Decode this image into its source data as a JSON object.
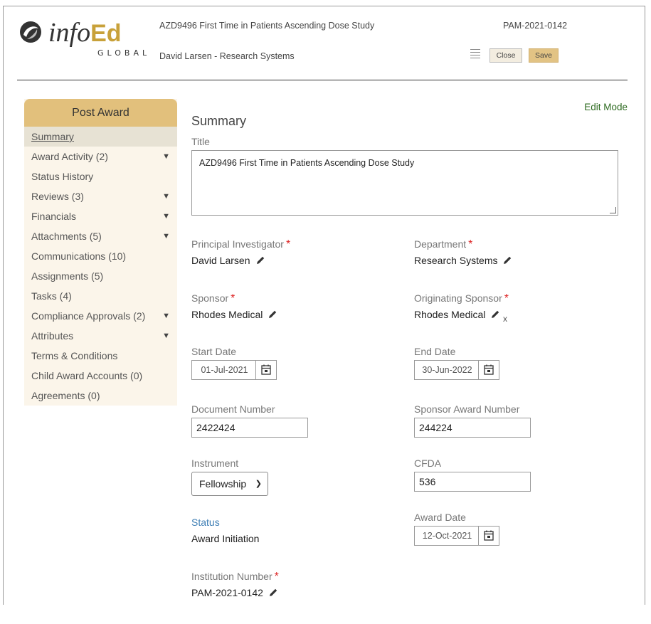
{
  "header": {
    "logo_main": "info",
    "logo_accent": "Ed",
    "logo_sub": "GLOBAL",
    "record_title": "AZD9496 First Time in Patients Ascending Dose Study",
    "record_id": "PAM-2021-0142",
    "user_line": "David Larsen - Research Systems",
    "close_label": "Close",
    "save_label": "Save"
  },
  "sidebar": {
    "title": "Post Award",
    "items": [
      {
        "label": "Summary",
        "expandable": false,
        "active": true
      },
      {
        "label": "Award Activity (2)",
        "expandable": true
      },
      {
        "label": "Status History",
        "expandable": false
      },
      {
        "label": "Reviews (3)",
        "expandable": true
      },
      {
        "label": "Financials",
        "expandable": true
      },
      {
        "label": "Attachments (5)",
        "expandable": true
      },
      {
        "label": "Communications (10)",
        "expandable": false
      },
      {
        "label": "Assignments (5)",
        "expandable": false
      },
      {
        "label": "Tasks (4)",
        "expandable": false
      },
      {
        "label": "Compliance Approvals (2)",
        "expandable": true
      },
      {
        "label": "Attributes",
        "expandable": true
      },
      {
        "label": "Terms & Conditions",
        "expandable": false
      },
      {
        "label": "Child Award Accounts (0)",
        "expandable": false
      },
      {
        "label": "Agreements (0)",
        "expandable": false
      }
    ]
  },
  "main": {
    "edit_mode": "Edit Mode",
    "section_title": "Summary",
    "title_label": "Title",
    "title_value": "AZD9496 First Time in Patients Ascending Dose Study",
    "pi_label": "Principal Investigator",
    "pi_value": "David Larsen",
    "dept_label": "Department",
    "dept_value": "Research Systems",
    "sponsor_label": "Sponsor",
    "sponsor_value": "Rhodes Medical",
    "orig_sponsor_label": "Originating Sponsor",
    "orig_sponsor_value": "Rhodes Medical",
    "orig_sponsor_remove": "x",
    "start_label": "Start Date",
    "start_value": "01-Jul-2021",
    "end_label": "End Date",
    "end_value": "30-Jun-2022",
    "docnum_label": "Document Number",
    "docnum_value": "2422424",
    "sponsor_award_label": "Sponsor Award Number",
    "sponsor_award_value": "244224",
    "instrument_label": "Instrument",
    "instrument_value": "Fellowship",
    "cfda_label": "CFDA",
    "cfda_value": "536",
    "status_label": "Status",
    "status_value": "Award Initiation",
    "award_date_label": "Award Date",
    "award_date_value": "12-Oct-2021",
    "inst_num_label": "Institution Number",
    "inst_num_value": "PAM-2021-0142",
    "required_mark": "*"
  },
  "colors": {
    "accent_gold": "#e2c07c",
    "sidebar_bg": "#fbf5ea",
    "edit_mode_green": "#2e6b21",
    "required_red": "#dd2222",
    "status_blue": "#3f7fb5"
  }
}
